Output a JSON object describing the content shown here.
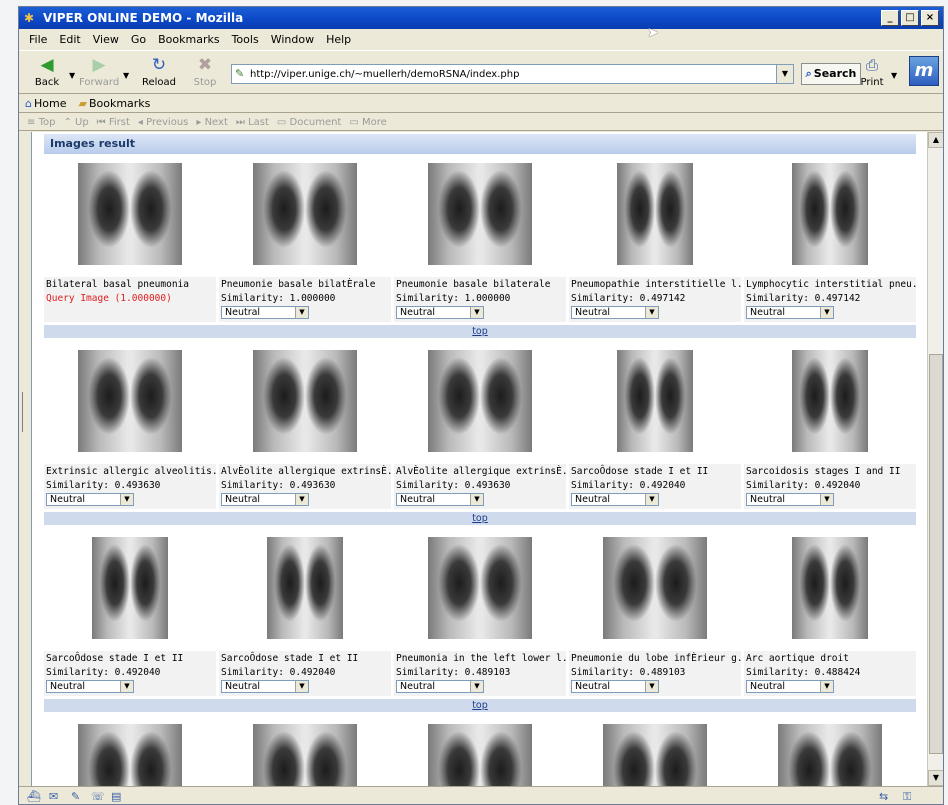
{
  "window": {
    "title": "VIPER ONLINE DEMO - Mozilla",
    "buttons": {
      "minimize": "_",
      "maximize": "□",
      "close": "×"
    }
  },
  "menu": [
    "File",
    "Edit",
    "View",
    "Go",
    "Bookmarks",
    "Tools",
    "Window",
    "Help"
  ],
  "nav": {
    "back": "Back",
    "forward": "Forward",
    "reload": "Reload",
    "stop": "Stop",
    "url": "http://viper.unige.ch/~muellerh/demoRSNA/index.php",
    "search": "Search",
    "print": "Print"
  },
  "personal": {
    "home": "Home",
    "bookmarks": "Bookmarks"
  },
  "sitenav": [
    "Top",
    "Up",
    "First",
    "Previous",
    "Next",
    "Last",
    "Document",
    "More"
  ],
  "content": {
    "header": "Images result",
    "top_link": "top",
    "rows": [
      {
        "cells": [
          {
            "title": "Bilateral basal pneumonia",
            "score": "Query Image (1.000000)",
            "query": true,
            "select": ""
          },
          {
            "title": "Pneumonie basale bilatÈrale",
            "score": "Similarity: 1.000000",
            "select": "Neutral"
          },
          {
            "title": "Pneumonie basale bilaterale",
            "score": "Similarity: 1.000000",
            "select": "Neutral"
          },
          {
            "title": "Pneumopathie interstitielle l...",
            "score": "Similarity: 0.497142",
            "select": "Neutral"
          },
          {
            "title": "Lymphocytic interstitial pneu...",
            "score": "Similarity: 0.497142",
            "select": "Neutral"
          }
        ]
      },
      {
        "cells": [
          {
            "title": "Extrinsic allergic alveolitis...",
            "score": "Similarity: 0.493630",
            "select": "Neutral"
          },
          {
            "title": "AlvÈolite allergique extrinsÈ...",
            "score": "Similarity: 0.493630",
            "select": "Neutral"
          },
          {
            "title": "AlvÈolite allergique extrinsÈ...",
            "score": "Similarity: 0.493630",
            "select": "Neutral"
          },
          {
            "title": "SarcoÔdose stade I et II",
            "score": "Similarity: 0.492040",
            "select": "Neutral"
          },
          {
            "title": "Sarcoidosis stages I and II",
            "score": "Similarity: 0.492040",
            "select": "Neutral"
          }
        ]
      },
      {
        "cells": [
          {
            "title": "SarcoÔdose stade I et II",
            "score": "Similarity: 0.492040",
            "select": "Neutral"
          },
          {
            "title": "SarcoÔdose stade I et II",
            "score": "Similarity: 0.492040",
            "select": "Neutral"
          },
          {
            "title": "Pneumonia in the left lower l...",
            "score": "Similarity: 0.489103",
            "select": "Neutral"
          },
          {
            "title": "Pneumonie du lobe infÈrieur g...",
            "score": "Similarity: 0.489103",
            "select": "Neutral"
          },
          {
            "title": "Arc aortique droit",
            "score": "Similarity: 0.488424",
            "select": "Neutral"
          }
        ]
      }
    ]
  }
}
